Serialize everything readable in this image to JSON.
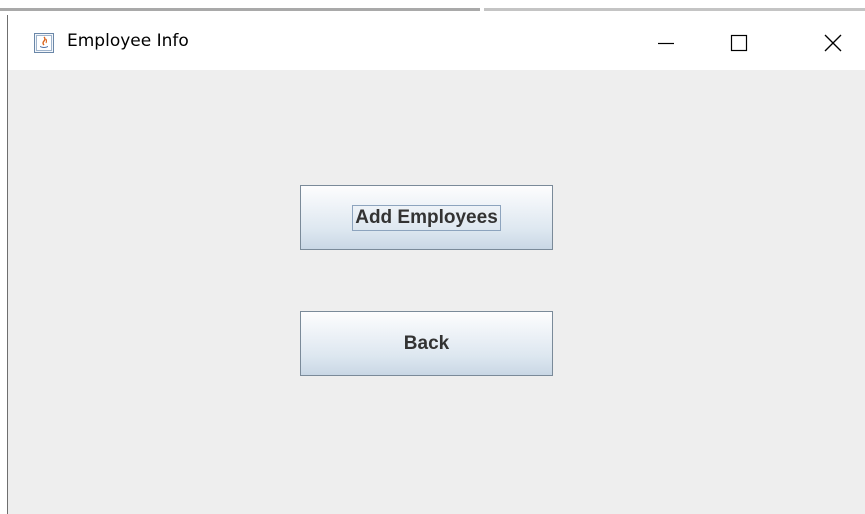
{
  "window": {
    "title": "Employee Info",
    "icon": "java-app-icon",
    "controls": {
      "minimize": "minimize-icon",
      "maximize": "maximize-icon",
      "close": "close-icon"
    }
  },
  "buttons": {
    "add_employees_label": "Add Employees",
    "back_label": "Back"
  },
  "colors": {
    "content_background": "#eeeeee",
    "titlebar_background": "#ffffff",
    "button_text": "#333333",
    "button_border": "#7a8a99"
  }
}
